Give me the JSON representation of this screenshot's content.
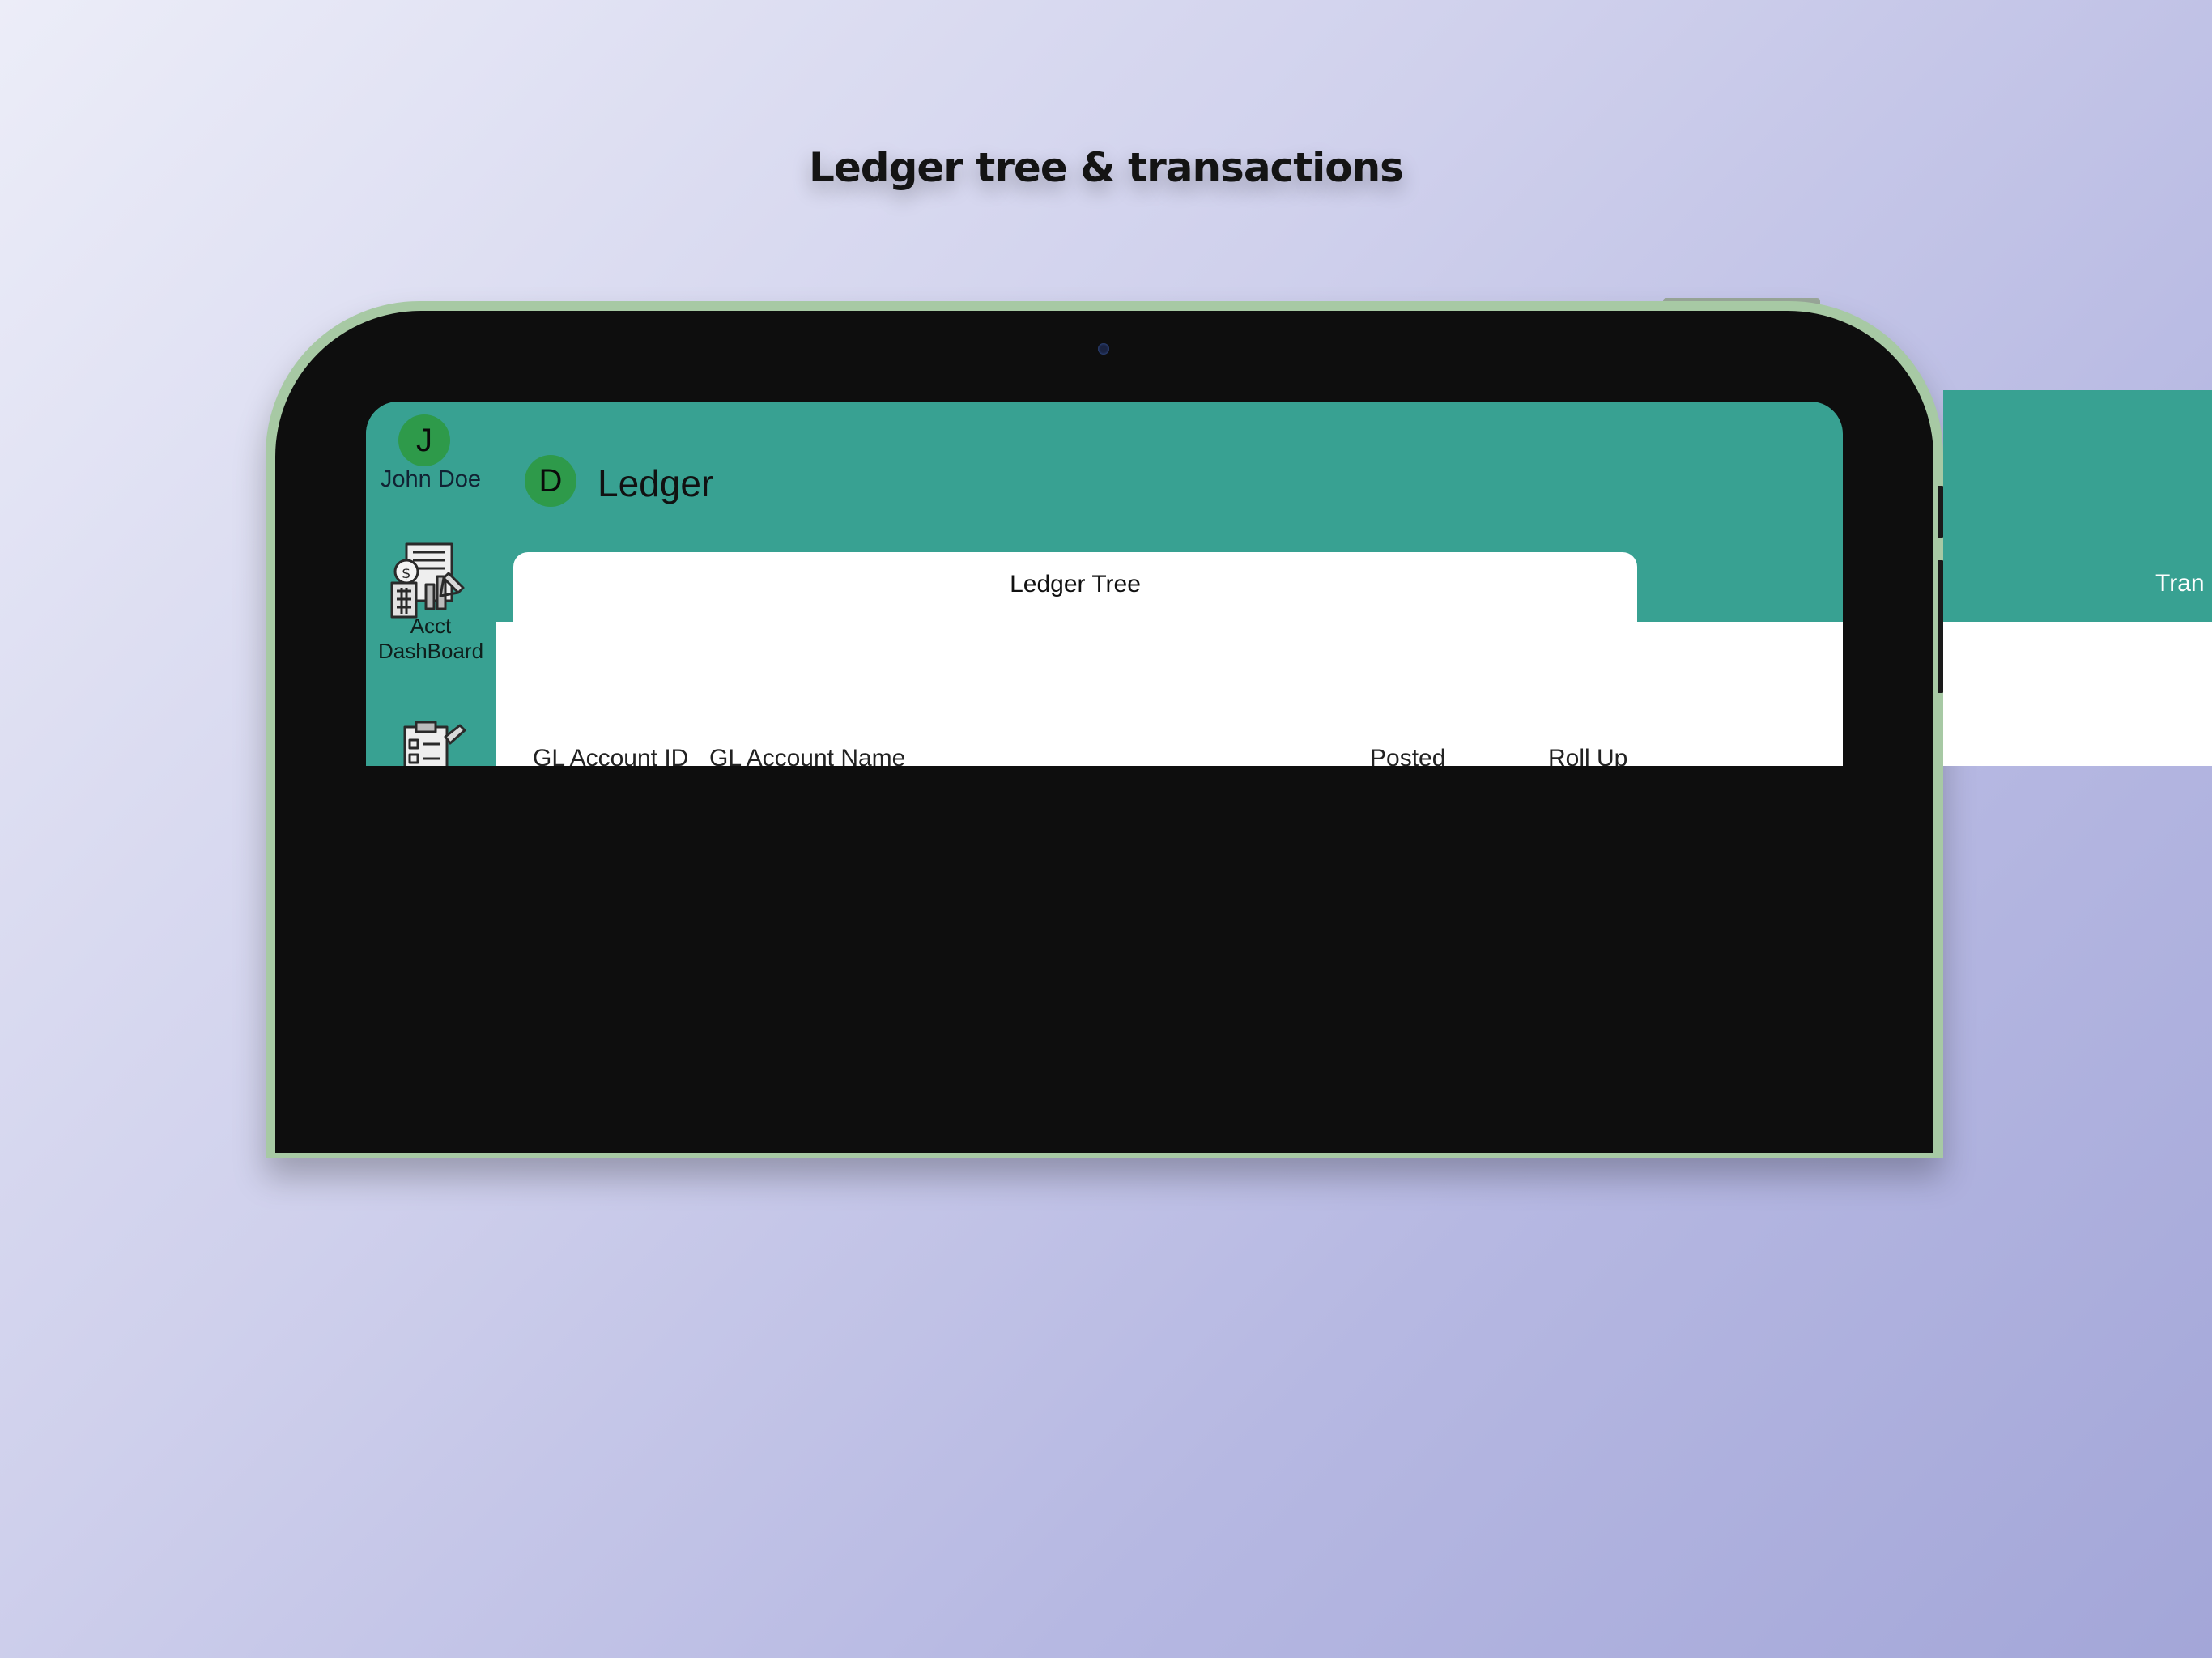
{
  "headline": "Ledger tree & transactions",
  "user": {
    "initial": "J",
    "name": "John Doe"
  },
  "sidebar": {
    "items": [
      {
        "label_line1": "Acct",
        "label_line2": "DashBoard",
        "icon": "accounting-dashboard-icon"
      },
      {
        "label_line1": "",
        "label_line2": "",
        "icon": "clipboard-edit-icon"
      }
    ]
  },
  "header": {
    "initial": "D",
    "title": "Ledger"
  },
  "tabs": [
    {
      "label": "Ledger Tree",
      "active": true
    },
    {
      "label": "Tran",
      "active": false
    }
  ],
  "table": {
    "columns": [
      "GL Account ID",
      "GL Account Name",
      "Posted",
      "Roll Up"
    ]
  },
  "colors": {
    "accent": "#38a192",
    "avatar": "#2e9a4a",
    "frame": "#a7c9a4",
    "bezel": "#0e0e0e"
  }
}
